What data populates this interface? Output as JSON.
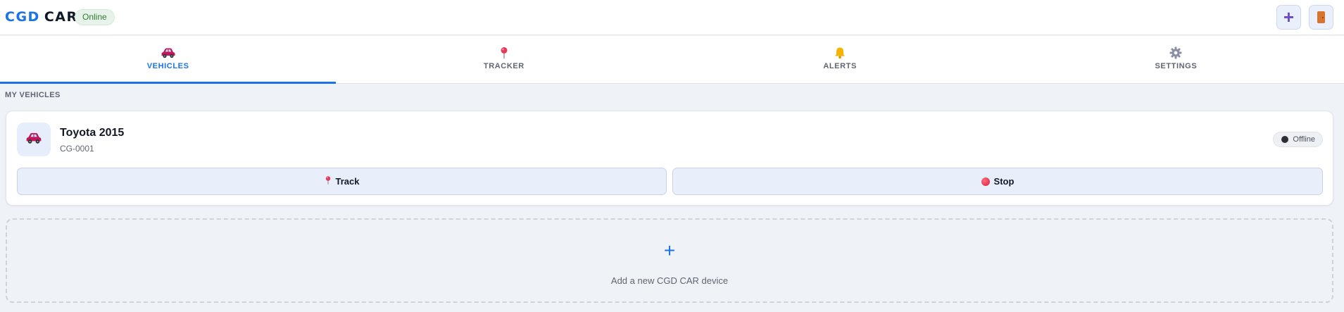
{
  "header": {
    "logo_part1": "CGD",
    "logo_part2": "CAR",
    "status": "Online",
    "add_icon": "plus-icon",
    "logout_icon": "door-icon"
  },
  "tabs": [
    {
      "label": "VEHICLES",
      "icon": "car-icon",
      "active": true
    },
    {
      "label": "TRACKER",
      "icon": "pin-icon",
      "active": false
    },
    {
      "label": "ALERTS",
      "icon": "bell-icon",
      "active": false
    },
    {
      "label": "SETTINGS",
      "icon": "gear-icon",
      "active": false
    }
  ],
  "section": {
    "title": "MY VEHICLES"
  },
  "vehicle": {
    "name": "Toyota 2015",
    "plate": "CG-0001",
    "status": "Offline",
    "track_label": "Track",
    "stop_label": "Stop"
  },
  "add_device": {
    "label": "Add a new CGD CAR device"
  },
  "colors": {
    "accent": "#1a73e8",
    "online_bg": "#e7f3ea",
    "online_text": "#2e7d32",
    "background": "#eff2f7"
  }
}
